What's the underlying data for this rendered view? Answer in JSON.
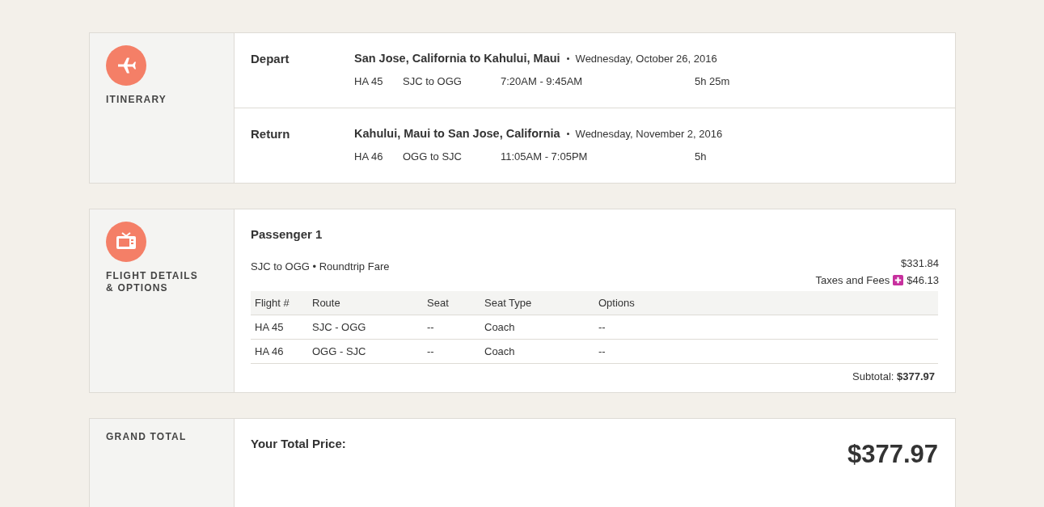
{
  "itinerary": {
    "label": "ITINERARY",
    "legs": [
      {
        "label": "Depart",
        "route": "San Jose, California to Kahului, Maui",
        "date": "Wednesday, October 26, 2016",
        "flight": "HA 45",
        "cities": "SJC to OGG",
        "times": "7:20AM - 9:45AM",
        "duration": "5h 25m"
      },
      {
        "label": "Return",
        "route": "Kahului, Maui to San Jose, California",
        "date": "Wednesday, November 2, 2016",
        "flight": "HA 46",
        "cities": "OGG to SJC",
        "times": "11:05AM - 7:05PM",
        "duration": "5h"
      }
    ]
  },
  "flight_details": {
    "label": "FLIGHT DETAILS & OPTIONS",
    "passenger": "Passenger 1",
    "fare": "SJC to OGG • Roundtrip Fare",
    "fare_price": "$331.84",
    "taxes_label": "Taxes and Fees",
    "taxes_price": "$46.13",
    "table": {
      "columns": [
        "Flight #",
        "Route",
        "Seat",
        "Seat Type",
        "Options"
      ],
      "rows": [
        [
          "HA 45",
          "SJC - OGG",
          "--",
          "Coach",
          "--"
        ],
        [
          "HA 46",
          "OGG - SJC",
          "--",
          "Coach",
          "--"
        ]
      ]
    },
    "subtotal": "Subtotal: **$377.97**"
  },
  "grand_total": {
    "label": "GRAND TOTAL",
    "price_label": "Your Total Price:",
    "price": "$377.97"
  }
}
